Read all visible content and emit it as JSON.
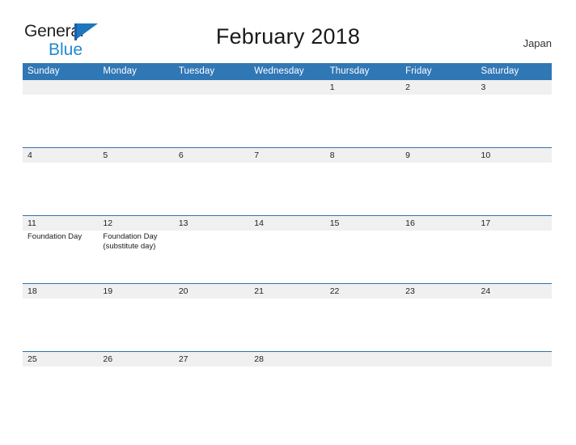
{
  "brand": {
    "name_part1": "General",
    "name_part2": "Blue",
    "flag_icon": "blue-flag-icon",
    "color_dark": "#231f20",
    "color_blue": "#1f8ad0"
  },
  "header": {
    "title": "February 2018",
    "country": "Japan"
  },
  "colors": {
    "header_blue": "#3077b6",
    "date_band_gray": "#f0f0f0",
    "separator_blue": "#2f74b2",
    "text_dark": "#1a1a1a"
  },
  "calendar": {
    "month": "February",
    "year": "2018",
    "weekday_headers": [
      "Sunday",
      "Monday",
      "Tuesday",
      "Wednesday",
      "Thursday",
      "Friday",
      "Saturday"
    ],
    "weeks": [
      {
        "dates": [
          "",
          "",
          "",
          "",
          "1",
          "2",
          "3"
        ],
        "events": [
          "",
          "",
          "",
          "",
          "",
          "",
          ""
        ]
      },
      {
        "dates": [
          "4",
          "5",
          "6",
          "7",
          "8",
          "9",
          "10"
        ],
        "events": [
          "",
          "",
          "",
          "",
          "",
          "",
          ""
        ]
      },
      {
        "dates": [
          "11",
          "12",
          "13",
          "14",
          "15",
          "16",
          "17"
        ],
        "events": [
          "Foundation Day",
          "Foundation Day\n(substitute day)",
          "",
          "",
          "",
          "",
          ""
        ]
      },
      {
        "dates": [
          "18",
          "19",
          "20",
          "21",
          "22",
          "23",
          "24"
        ],
        "events": [
          "",
          "",
          "",
          "",
          "",
          "",
          ""
        ]
      },
      {
        "dates": [
          "25",
          "26",
          "27",
          "28",
          "",
          "",
          ""
        ],
        "events": [
          "",
          "",
          "",
          "",
          "",
          "",
          ""
        ]
      }
    ]
  }
}
